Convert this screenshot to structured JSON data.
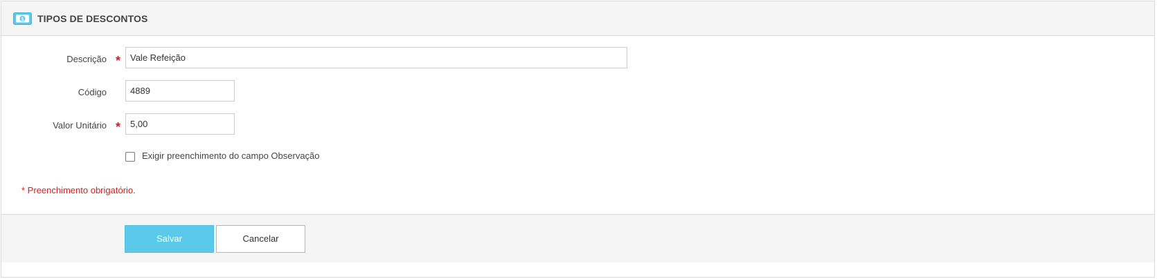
{
  "header": {
    "title": "TIPOS DE DESCONTOS",
    "icon": "money-bill-icon",
    "icon_color": "#5bc9ea"
  },
  "form": {
    "descricao": {
      "label": "Descrição",
      "required": true,
      "value": "Vale Refeição"
    },
    "codigo": {
      "label": "Código",
      "required": false,
      "value": "4889"
    },
    "valor_unitario": {
      "label": "Valor Unitário",
      "required": true,
      "value": "5,00"
    },
    "exigir_observacao": {
      "label": "Exigir preenchimento do campo Observação",
      "checked": false
    },
    "required_star": "*",
    "required_note": "* Preenchimento obrigatório."
  },
  "footer": {
    "save_label": "Salvar",
    "cancel_label": "Cancelar"
  },
  "colors": {
    "primary": "#5bc9ea",
    "required": "#e01a1a",
    "header_bg": "#f5f5f5"
  }
}
